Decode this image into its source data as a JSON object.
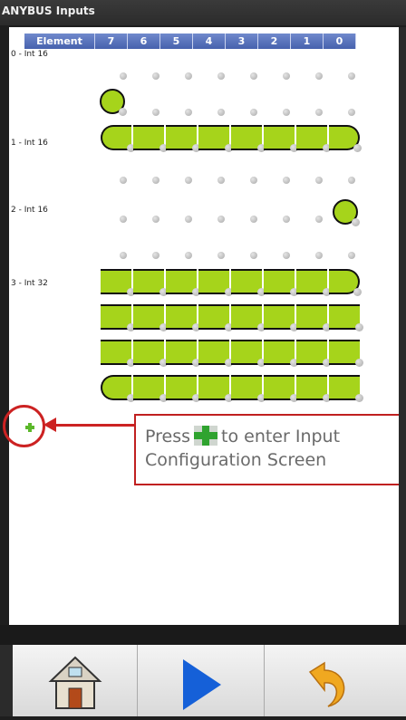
{
  "window": {
    "title": "ANYBUS Inputs"
  },
  "table": {
    "header": [
      "Element",
      "7",
      "6",
      "5",
      "4",
      "3",
      "2",
      "1",
      "0"
    ],
    "rows": [
      {
        "label": "0 - Int 16"
      },
      {
        "label": "1 - Int 16"
      },
      {
        "label": "2 - Int 16"
      },
      {
        "label": "3 - Int 32"
      }
    ]
  },
  "callout": {
    "line1_before": "Press",
    "line1_after": "to enter Input",
    "line2": "Configuration Screen"
  },
  "toolbar": {
    "home": "home-icon",
    "play": "play-icon",
    "undo": "undo-icon"
  },
  "colors": {
    "active_bit": "#a6d41b",
    "header": "#4661ad",
    "callout": "#cc2222"
  }
}
